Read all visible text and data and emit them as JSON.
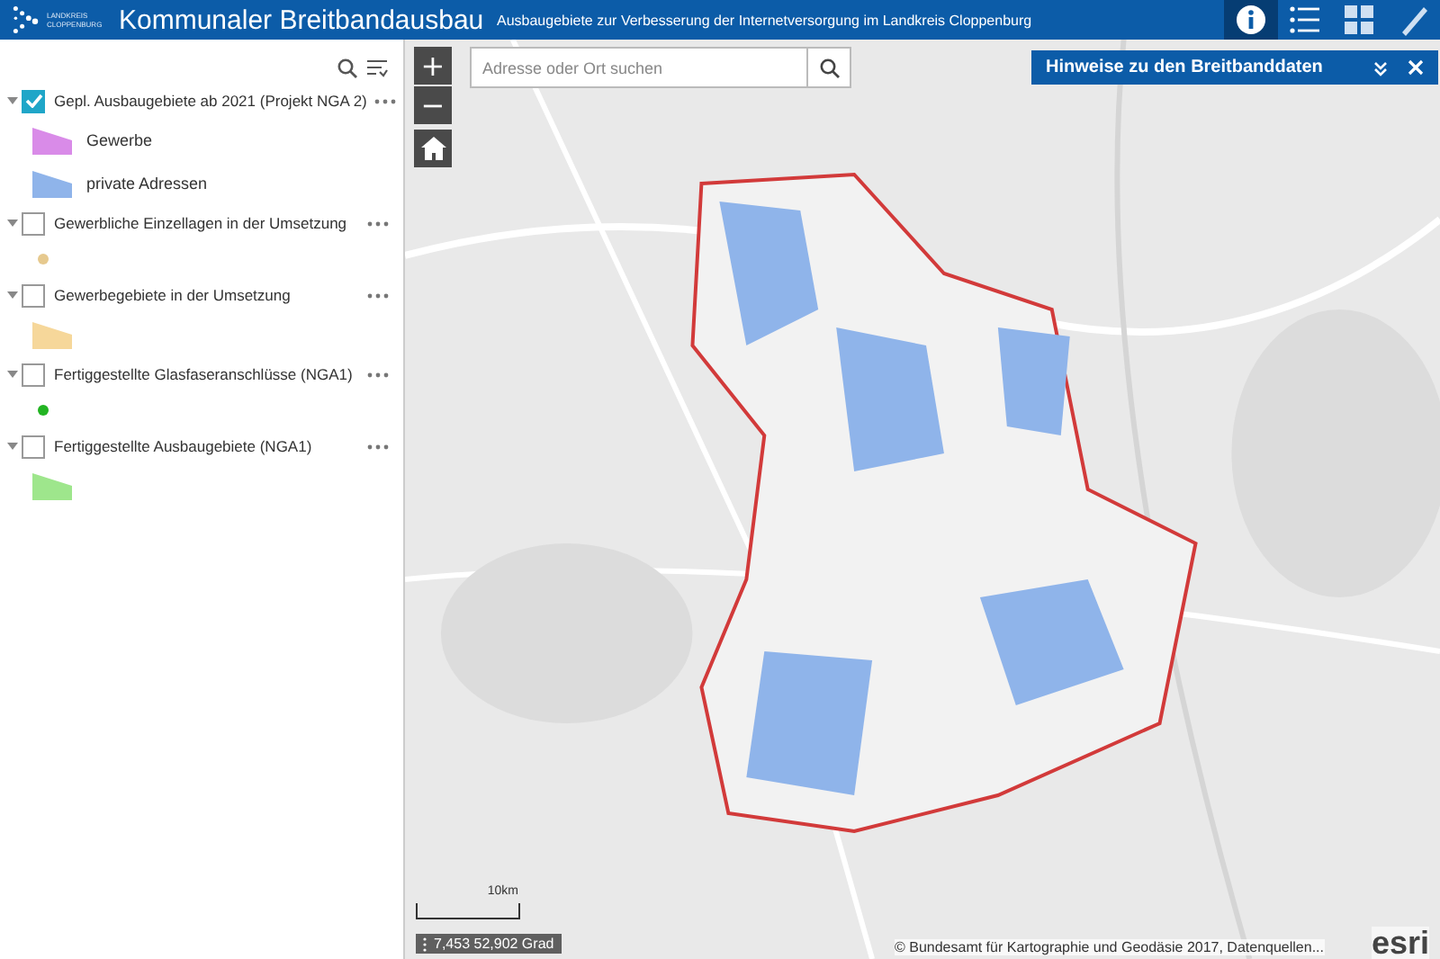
{
  "header": {
    "logo_text": [
      "LANDKREIS",
      "CLOPPENBURG"
    ],
    "title": "Kommunaler Breitbandausbau",
    "subtitle": "Ausbaugebiete zur Verbesserung der Internetversorgung im Landkreis Cloppenburg",
    "tools": [
      {
        "kind": "info",
        "selected": true
      },
      {
        "kind": "list",
        "selected": false
      },
      {
        "kind": "grid",
        "selected": false
      },
      {
        "kind": "ruler",
        "selected": false
      }
    ]
  },
  "layers": [
    {
      "title": "Gepl. Ausbaugebiete ab 2021 (Projekt NGA 2)",
      "checked": true,
      "expanded": true,
      "legend": [
        {
          "kind": "polygon",
          "color": "#d98be8",
          "label": "Gewerbe"
        },
        {
          "kind": "polygon",
          "color": "#8fb4ea",
          "label": "private Adressen"
        }
      ]
    },
    {
      "title": "Gewerbliche Einzellagen in der Umsetzung",
      "checked": false,
      "expanded": true,
      "legend": [
        {
          "kind": "dot",
          "color": "#e6c98e"
        }
      ]
    },
    {
      "title": "Gewerbegebiete in der Umsetzung",
      "checked": false,
      "expanded": true,
      "legend": [
        {
          "kind": "polygon",
          "color": "#f6d79a"
        }
      ]
    },
    {
      "title": "Fertiggestellte Glasfaseranschlüsse (NGA1)",
      "checked": false,
      "expanded": true,
      "legend": [
        {
          "kind": "dot",
          "color": "#22b422"
        }
      ]
    },
    {
      "title": "Fertiggestellte Ausbaugebiete (NGA1)",
      "checked": false,
      "expanded": true,
      "legend": [
        {
          "kind": "polygon",
          "color": "#9ee68c"
        }
      ]
    }
  ],
  "map": {
    "search": {
      "placeholder": "Adresse oder Ort suchen"
    },
    "zoom": [
      "+",
      "−"
    ],
    "panel": {
      "title": "Hinweise zu den Breitbanddaten"
    },
    "scale": "10km",
    "coordinates": "7,453 52,902 Grad",
    "attribution": "© Bundesamt für Kartographie und Geodäsie 2017, Datenquellen...",
    "logo": "esri"
  }
}
